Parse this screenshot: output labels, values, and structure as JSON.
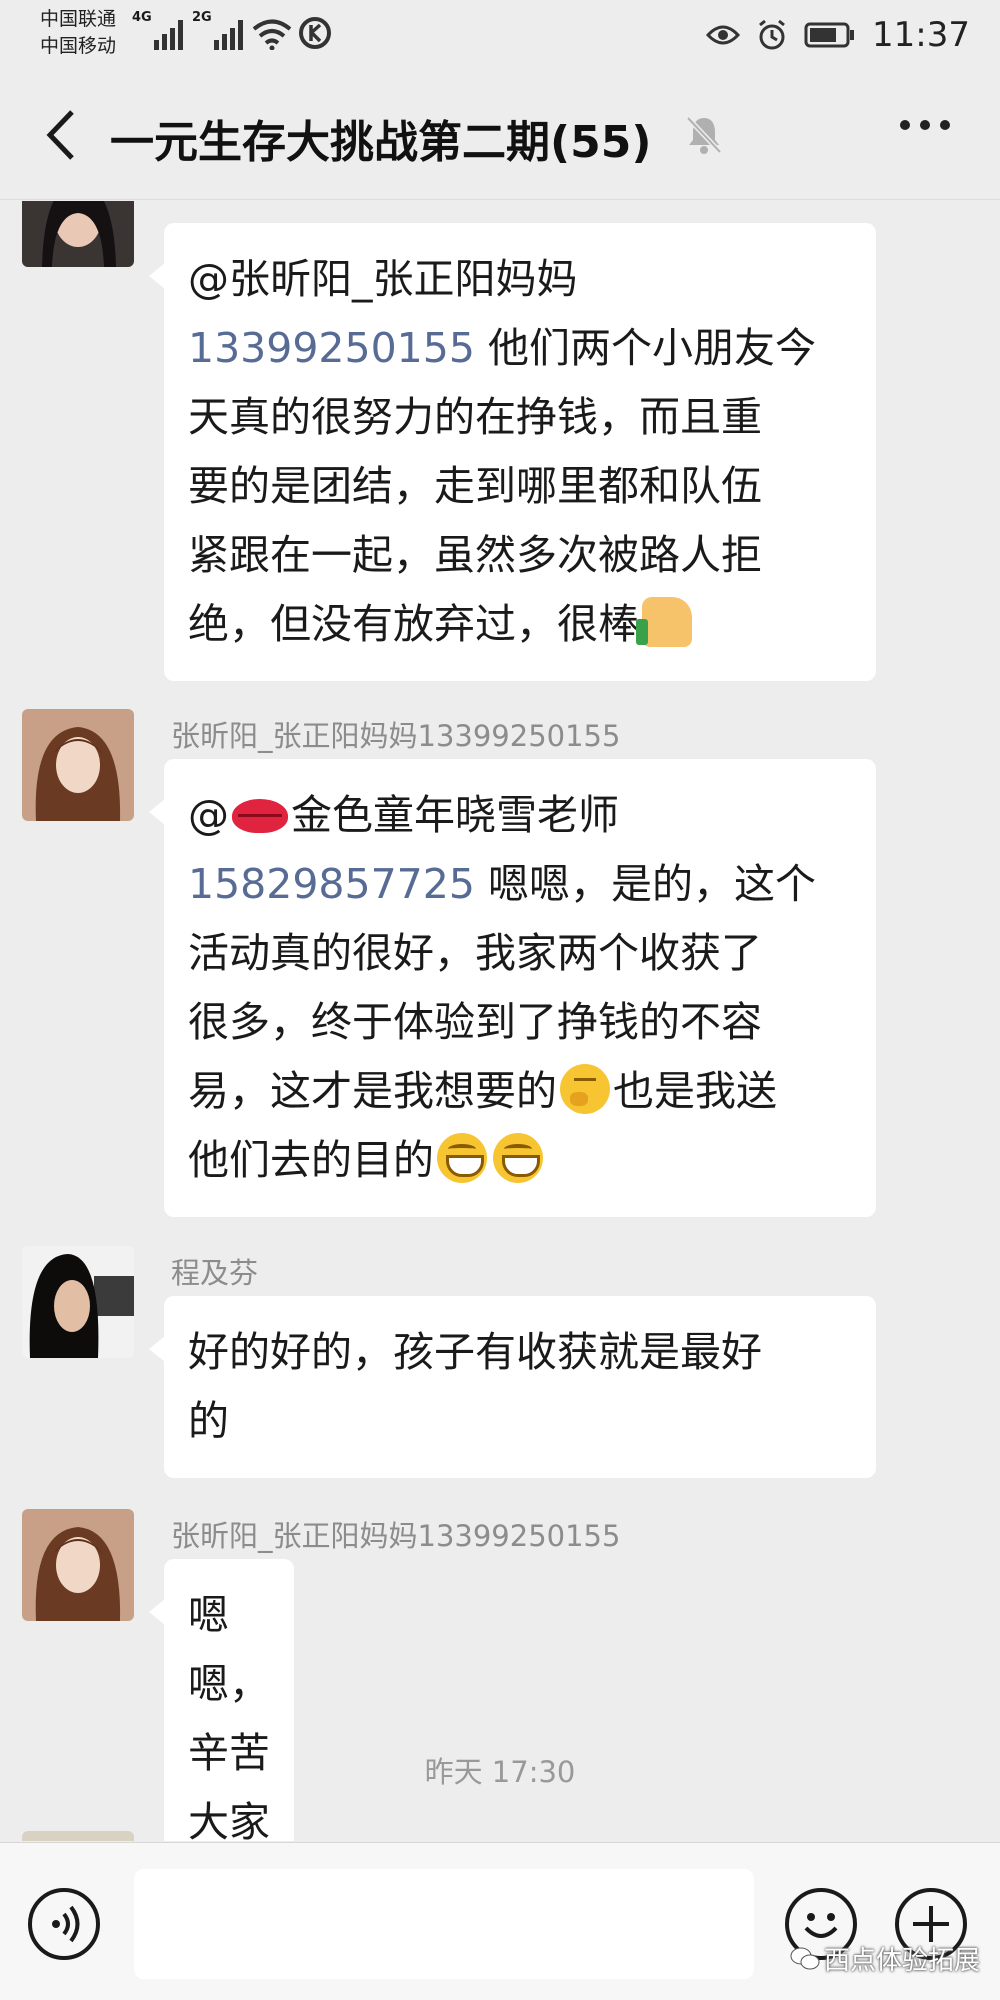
{
  "status_bar": {
    "carrier_1": "中国联通",
    "carrier_2": "中国移动",
    "net_1": "4G",
    "net_2": "2G",
    "time": "11:37"
  },
  "header": {
    "back_icon": "chevron-left-icon",
    "title": "一元生存大挑战第二期(55)",
    "mute_icon": "bell-muted-icon",
    "more_icon": "more-dots-icon"
  },
  "messages": [
    {
      "sender": "",
      "lines": [
        [
          {
            "t": "text",
            "v": "@张昕阳_张正阳妈妈"
          }
        ],
        [
          {
            "t": "phone",
            "v": "13399250155"
          },
          {
            "t": "text",
            "v": " 他们两个小朋友今"
          }
        ],
        [
          {
            "t": "text",
            "v": "天真的很努力的在挣钱，而且重"
          }
        ],
        [
          {
            "t": "text",
            "v": "要的是团结，走到哪里都和队伍"
          }
        ],
        [
          {
            "t": "text",
            "v": "紧跟在一起，虽然多次被路人拒"
          }
        ],
        [
          {
            "t": "text",
            "v": "绝，但没有放弃过，很棒"
          },
          {
            "t": "emoji",
            "v": "thumbs-up-emoji"
          }
        ]
      ]
    },
    {
      "sender": "张昕阳_张正阳妈妈13399250155",
      "lines": [
        [
          {
            "t": "text",
            "v": "@"
          },
          {
            "t": "emoji",
            "v": "kiss-lips-emoji"
          },
          {
            "t": "text",
            "v": "金色童年晓雪老师"
          }
        ],
        [
          {
            "t": "phone",
            "v": "15829857725"
          },
          {
            "t": "text",
            "v": " 嗯嗯，是的，这个"
          }
        ],
        [
          {
            "t": "text",
            "v": "活动真的很好，我家两个收获了"
          }
        ],
        [
          {
            "t": "text",
            "v": "很多，终于体验到了挣钱的不容"
          }
        ],
        [
          {
            "t": "text",
            "v": "易，这才是我想要的"
          },
          {
            "t": "emoji",
            "v": "thinking-emoji"
          },
          {
            "t": "text",
            "v": "也是我送"
          }
        ],
        [
          {
            "t": "text",
            "v": "他们去的目的"
          },
          {
            "t": "emoji",
            "v": "grin-emoji"
          },
          {
            "t": "emoji",
            "v": "grin-emoji"
          }
        ]
      ]
    },
    {
      "sender": "程及芬",
      "lines": [
        [
          {
            "t": "text",
            "v": "好的好的，孩子有收获就是最好"
          }
        ],
        [
          {
            "t": "text",
            "v": "的"
          }
        ]
      ]
    },
    {
      "sender": "张昕阳_张正阳妈妈13399250155",
      "lines": [
        [
          {
            "t": "text",
            "v": "嗯嗯，辛苦大家了"
          }
        ]
      ]
    }
  ],
  "timestamp": "昨天 17:30",
  "input_bar": {
    "voice_icon": "voice-icon",
    "emoji_icon": "emoji-icon",
    "plus_icon": "plus-icon",
    "text_value": ""
  },
  "watermark": "西点体验拓展"
}
